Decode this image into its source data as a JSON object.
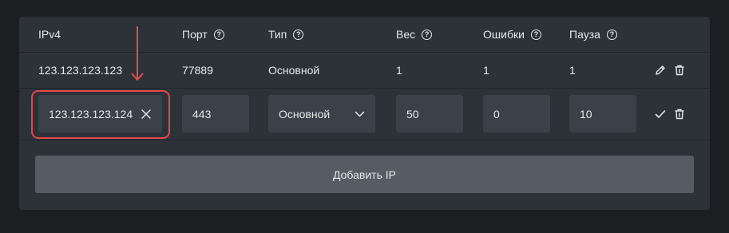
{
  "table": {
    "columns": [
      {
        "label": "IPv4",
        "help": false
      },
      {
        "label": "Порт",
        "help": true
      },
      {
        "label": "Тип",
        "help": true
      },
      {
        "label": "Вес",
        "help": true
      },
      {
        "label": "Ошибки",
        "help": true
      },
      {
        "label": "Пауза",
        "help": true
      }
    ],
    "help_glyph": "?",
    "row": {
      "ip": "123.123.123.123",
      "port": "77889",
      "type": "Основной",
      "weight": "1",
      "errors": "1",
      "pause": "1"
    },
    "edit_row": {
      "ip": "123.123.123.124",
      "port": "443",
      "type": "Основной",
      "weight": "50",
      "errors": "0",
      "pause": "10"
    }
  },
  "add_button_label": "Добавить IP",
  "colors": {
    "background": "#1d1e21",
    "panel": "#2c3238",
    "field": "#3a4149",
    "button": "#555c64",
    "annotation": "#e5484d"
  }
}
